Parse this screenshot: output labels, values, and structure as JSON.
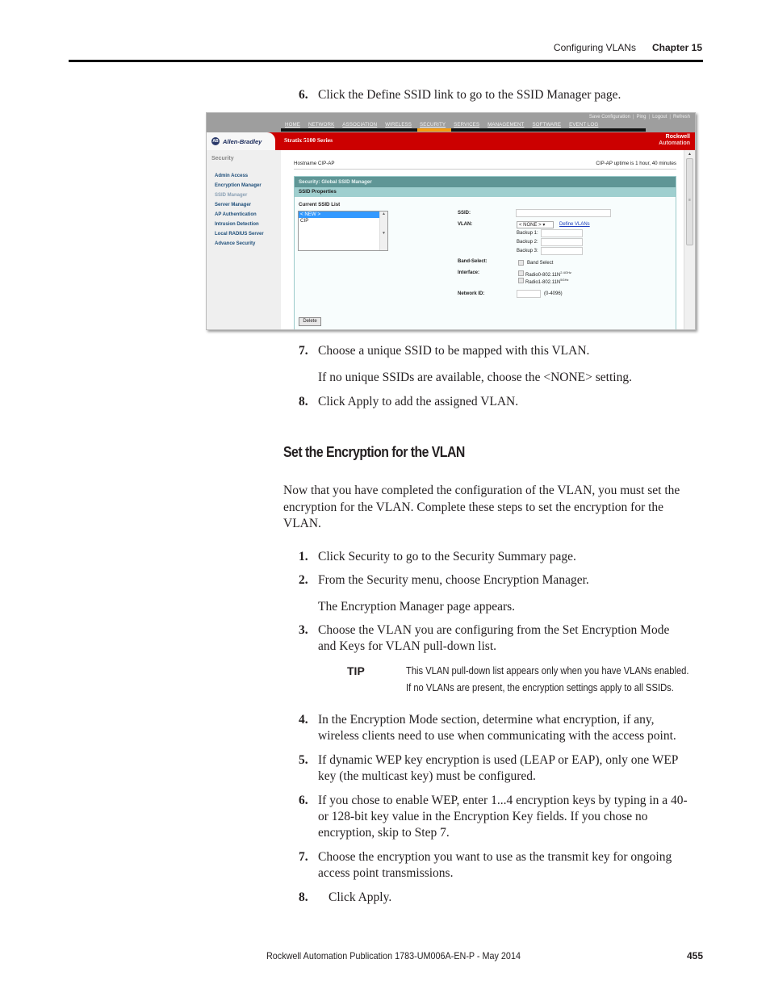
{
  "header": {
    "section": "Configuring VLANs",
    "chapter": "Chapter 15"
  },
  "step6_intro": {
    "num": "6.",
    "text": "Click the Define SSID link to go to the SSID Manager page."
  },
  "screenshot": {
    "util_links": [
      "Save Configuration",
      "Ping",
      "Logout",
      "Refresh"
    ],
    "util_sep": "|",
    "nav": [
      "HOME",
      "NETWORK",
      "ASSOCIATION",
      "WIRELESS",
      "SECURITY",
      "SERVICES",
      "MANAGEMENT",
      "SOFTWARE",
      "EVENT LOG"
    ],
    "active_nav": "SECURITY",
    "brand": {
      "logo_mark": "AB",
      "logo_text": "Allen-Bradley",
      "series": "Stratix 5100 Series",
      "rockwell_line1": "Rockwell",
      "rockwell_line2": "Automation"
    },
    "colors": {
      "brand_red": "#cc0000",
      "nav_active": "#f39c12",
      "panel_header": "#5f9696",
      "panel_sub": "#9fcfcf"
    },
    "sidebar": {
      "title": "Security",
      "items": [
        "Admin Access",
        "Encryption Manager",
        "SSID Manager",
        "Server Manager",
        "AP Authentication",
        "Intrusion Detection",
        "Local RADIUS Server",
        "Advance Security"
      ],
      "current": "SSID Manager"
    },
    "hostname": "Hostname  CIP-AP",
    "uptime": "CIP-AP uptime is 1 hour, 40 minutes",
    "panel_title": "Security: Global SSID Manager",
    "panel_subtitle": "SSID Properties",
    "ssid_list_label": "Current SSID List",
    "ssid_list": [
      "< NEW >",
      "CIP"
    ],
    "ssid_list_selected": "< NEW >",
    "fields": {
      "ssid_label": "SSID:",
      "ssid_value": "",
      "vlan_label": "VLAN:",
      "vlan_value": "< NONE >",
      "define_vlans": "Define VLANs",
      "backup1": "Backup 1:",
      "backup2": "Backup 2:",
      "backup3": "Backup 3:",
      "band_select_label": "Band-Select:",
      "band_select_option": "Band Select",
      "interface_label": "Interface:",
      "radio0": "Radio0-802.11N",
      "radio0_sup": "2.4GHz",
      "radio1": "Radio1-802.11N",
      "radio1_sup": "5GHz",
      "network_id_label": "Network ID:",
      "network_id_value": "",
      "network_id_range": "(0-4096)"
    },
    "delete_button": "Delete"
  },
  "steps_a": [
    {
      "num": "7.",
      "text": "Choose a unique SSID to be mapped with this VLAN."
    },
    {
      "num": "8.",
      "text": "Click Apply to add the assigned VLAN."
    }
  ],
  "note_7": "If no unique SSIDs are available, choose the <NONE> setting.",
  "section_title": "Set the Encryption for the VLAN",
  "section_intro": "Now that you have completed the configuration of the VLAN, you must set the encryption for the VLAN. Complete these steps to set the encryption for the VLAN.",
  "steps_b": [
    {
      "num": "1.",
      "text": "Click Security to go to the Security Summary page."
    },
    {
      "num": "2.",
      "text": "From the Security menu, choose Encryption Manager."
    },
    {
      "num": "3.",
      "text": "Choose the VLAN you are configuring from the Set Encryption Mode and Keys for VLAN pull-down list."
    },
    {
      "num": "4.",
      "text": "In the Encryption Mode section, determine what encryption, if any, wireless clients need to use when communicating with the access point."
    },
    {
      "num": "5.",
      "text": "If dynamic WEP key encryption is used (LEAP or EAP), only one WEP key (the multicast key) must be configured."
    },
    {
      "num": "6.",
      "text": "If you chose to enable WEP, enter 1...4 encryption keys by typing in a 40- or 128-bit key value in the Encryption Key fields. If you chose no encryption, skip to Step 7."
    },
    {
      "num": "7.",
      "text": "Choose the encryption you want to use as the transmit key for ongoing access point transmissions."
    },
    {
      "num": "8.",
      "text": "Click Apply."
    }
  ],
  "note_2": "The Encryption Manager page appears.",
  "tip": {
    "label": "TIP",
    "line1": "This VLAN pull-down list appears only when you have VLANs enabled.",
    "line2": "If no VLANs are present, the encryption settings apply to all SSIDs."
  },
  "footer": {
    "publication": "Rockwell Automation Publication 1783-UM006A-EN-P - May 2014",
    "page": "455"
  }
}
